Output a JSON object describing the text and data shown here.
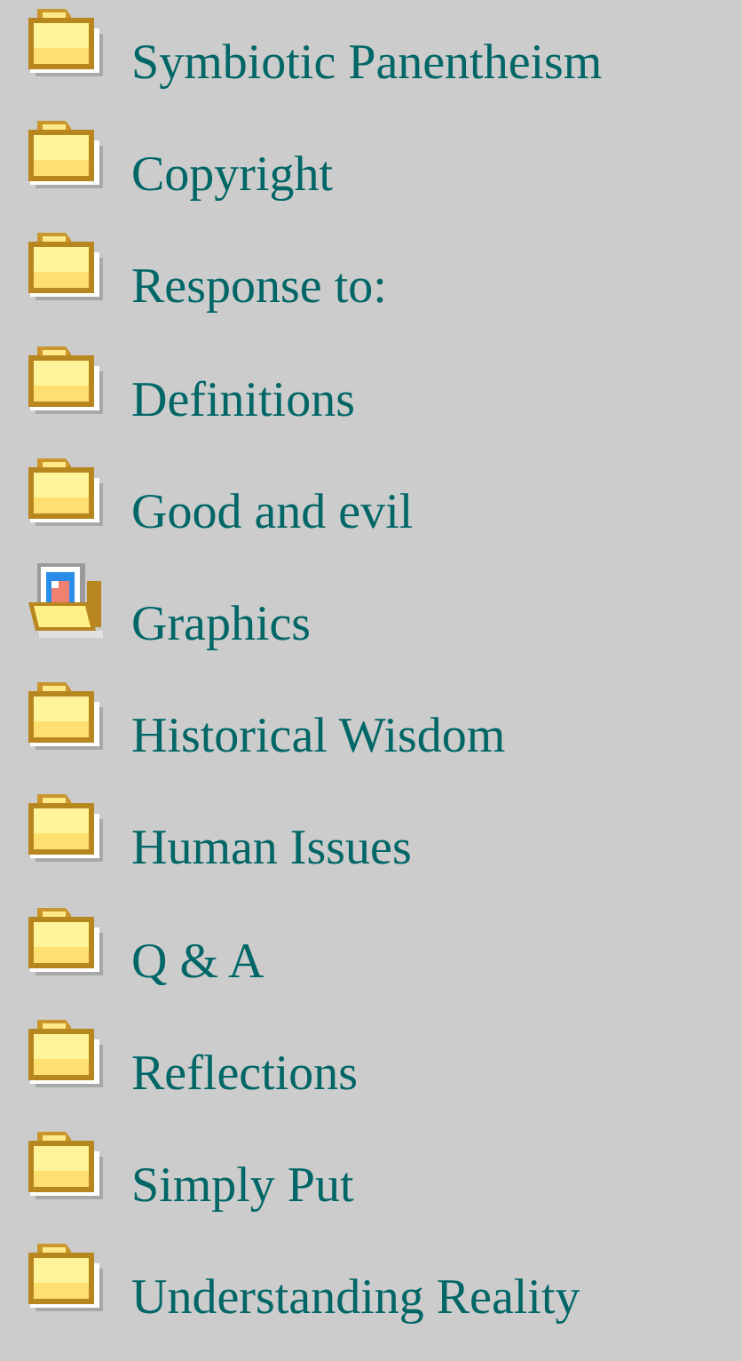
{
  "links": [
    {
      "label": "Symbiotic Panentheism",
      "kind": "folder"
    },
    {
      "label": "Copyright",
      "kind": "folder"
    },
    {
      "label": "Response to:",
      "kind": "folder"
    },
    {
      "label": "Definitions",
      "kind": "folder"
    },
    {
      "label": "Good and evil",
      "kind": "folder"
    },
    {
      "label": "Graphics",
      "kind": "picture-folder"
    },
    {
      "label": "Historical Wisdom",
      "kind": "folder"
    },
    {
      "label": "Human Issues",
      "kind": "folder"
    },
    {
      "label": "Q & A",
      "kind": "folder"
    },
    {
      "label": "Reflections",
      "kind": "folder"
    },
    {
      "label": "Simply Put",
      "kind": "folder"
    },
    {
      "label": "Understanding Reality",
      "kind": "folder"
    }
  ]
}
